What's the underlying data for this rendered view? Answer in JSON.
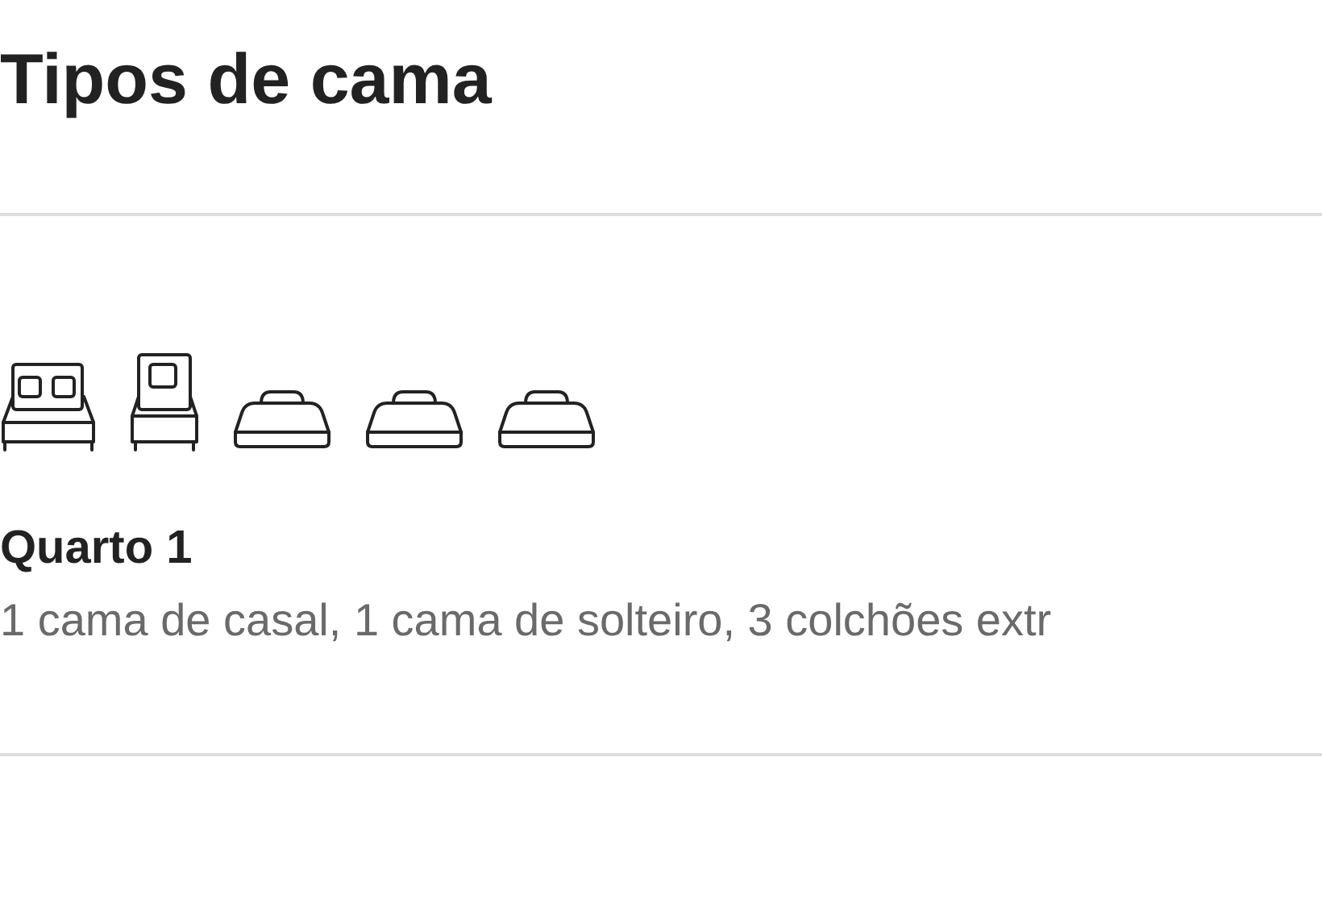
{
  "title": "Tipos de cama",
  "room": {
    "beds": [
      {
        "kind": "double"
      },
      {
        "kind": "single"
      },
      {
        "kind": "mattress"
      },
      {
        "kind": "mattress"
      },
      {
        "kind": "mattress"
      }
    ],
    "name": "Quarto 1",
    "description": "1 cama de casal, 1 cama de solteiro, 3 colchões extr"
  }
}
